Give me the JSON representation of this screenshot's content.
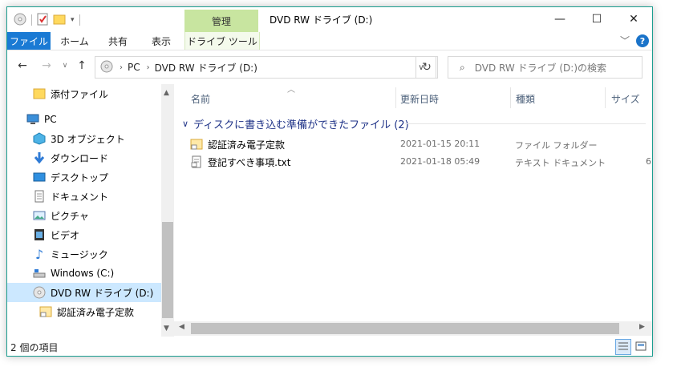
{
  "window": {
    "title": "DVD RW ドライブ (D:)",
    "context_tab": "管理",
    "accent": "#1a7ad4",
    "context_color": "#c8e5a0"
  },
  "ribbon": {
    "tabs": [
      {
        "label": "ファイル",
        "name": "tab-file"
      },
      {
        "label": "ホーム",
        "name": "tab-home"
      },
      {
        "label": "共有",
        "name": "tab-share"
      },
      {
        "label": "表示",
        "name": "tab-view"
      },
      {
        "label": "ドライブ ツール",
        "name": "tab-drive-tools"
      }
    ]
  },
  "address": {
    "crumbs": [
      "PC",
      "DVD RW ドライブ (D:)"
    ],
    "search_placeholder": "DVD RW ドライブ (D:)の検索"
  },
  "nav": {
    "items": [
      {
        "label": "添付ファイル",
        "icon": "folder-icon"
      },
      {
        "label": "PC",
        "icon": "pc-icon"
      },
      {
        "label": "3D オブジェクト",
        "icon": "3d-objects-icon"
      },
      {
        "label": "ダウンロード",
        "icon": "download-icon"
      },
      {
        "label": "デスクトップ",
        "icon": "desktop-icon"
      },
      {
        "label": "ドキュメント",
        "icon": "documents-icon"
      },
      {
        "label": "ピクチャ",
        "icon": "pictures-icon"
      },
      {
        "label": "ビデオ",
        "icon": "videos-icon"
      },
      {
        "label": "ミュージック",
        "icon": "music-icon"
      },
      {
        "label": "Windows (C:)",
        "icon": "hard-drive-icon"
      },
      {
        "label": "DVD RW ドライブ (D:)",
        "icon": "dvd-drive-icon"
      },
      {
        "label": "認証済み電子定款",
        "icon": "folder-icon"
      }
    ]
  },
  "columns": {
    "name": "名前",
    "modified": "更新日時",
    "type": "種類",
    "size": "サイズ"
  },
  "group": {
    "label": "ディスクに書き込む準備ができたファイル (2)"
  },
  "files": [
    {
      "name": "認証済み電子定款",
      "modified": "2021-01-15 20:11",
      "type": "ファイル フォルダー",
      "size": ""
    },
    {
      "name": "登記すべき事項.txt",
      "modified": "2021-01-18 05:49",
      "type": "テキスト ドキュメント",
      "size": "6"
    }
  ],
  "status": {
    "count_text": "2 個の項目"
  }
}
